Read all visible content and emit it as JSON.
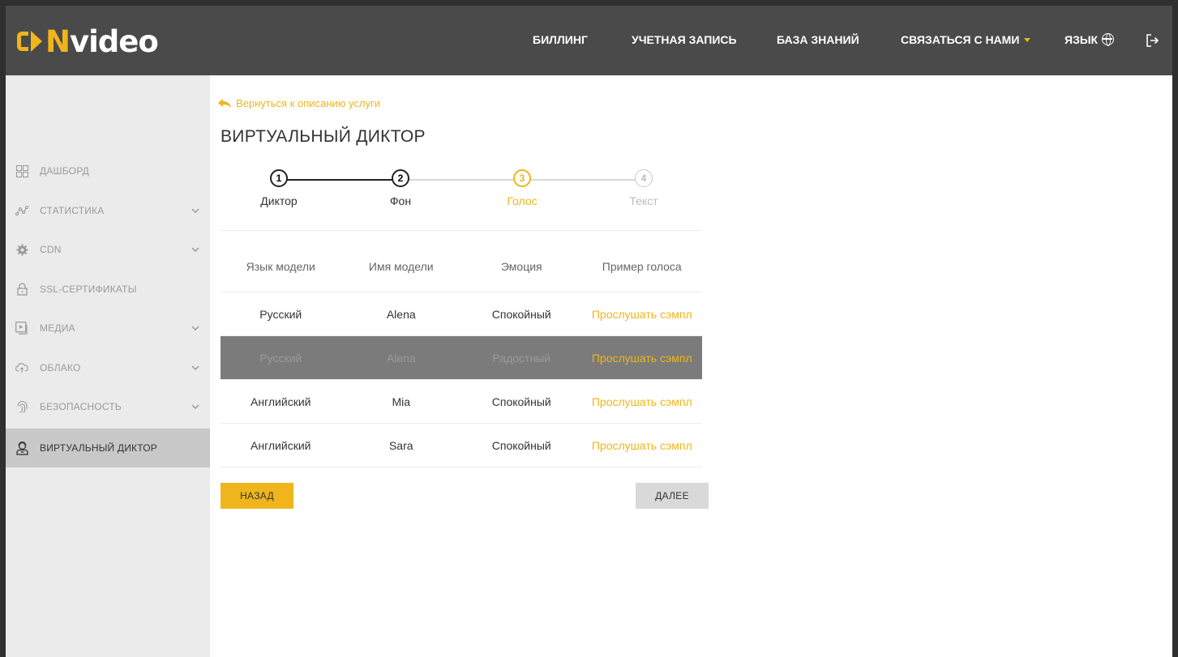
{
  "header": {
    "logo_mark": "CDN",
    "logo_text": "video",
    "nav": {
      "billing": "БИЛЛИНГ",
      "account": "УЧЕТНАЯ ЗАПИСЬ",
      "knowledge": "БАЗА ЗНАНИЙ",
      "contact": "СВЯЗАТЬСЯ С НАМИ",
      "language": "ЯЗЫК"
    }
  },
  "sidebar": {
    "items": [
      {
        "label": "ДАШБОРД",
        "icon": "dashboard-icon"
      },
      {
        "label": "СТАТИСТИКА",
        "icon": "statistics-icon"
      },
      {
        "label": "CDN",
        "icon": "gear-icon"
      },
      {
        "label": "SSL-СЕРТИФИКАТЫ",
        "icon": "lock-icon"
      },
      {
        "label": "МЕДИА",
        "icon": "media-icon"
      },
      {
        "label": "ОБЛАКО",
        "icon": "cloud-icon"
      },
      {
        "label": "БЕЗОПАСНОСТЬ",
        "icon": "fingerprint-icon"
      },
      {
        "label": "ВИРТУАЛЬНЫЙ ДИКТОР",
        "icon": "announcer-icon"
      }
    ]
  },
  "main": {
    "back_link": "Вернуться к описанию услуги",
    "title": "ВИРТУАЛЬНЫЙ ДИКТОР",
    "steps": [
      {
        "num": "1",
        "label": "Диктор",
        "state": "done"
      },
      {
        "num": "2",
        "label": "Фон",
        "state": "done"
      },
      {
        "num": "3",
        "label": "Голос",
        "state": "current"
      },
      {
        "num": "4",
        "label": "Текст",
        "state": "todo"
      }
    ],
    "table": {
      "headers": [
        "Язык модели",
        "Имя модели",
        "Эмоция",
        "Пример голоса"
      ],
      "rows": [
        [
          "Русский",
          "Alena",
          "Спокойный",
          "Прослушать сэмпл"
        ],
        [
          "Русский",
          "Alena",
          "Радостный",
          "Прослушать сэмпл"
        ],
        [
          "Английский",
          "Mia",
          "Спокойный",
          "Прослушать сэмпл"
        ],
        [
          "Английский",
          "Sara",
          "Спокойный",
          "Прослушать сэмпл"
        ]
      ],
      "selected_row": 1
    },
    "buttons": {
      "back": "НАЗАД",
      "next": "ДАЛЕЕ"
    }
  },
  "colors": {
    "accent": "#f0b51c",
    "header_bg": "#4a4a4a",
    "sidebar_bg": "#ebebeb",
    "selected_row_bg": "#7b7b7b"
  }
}
